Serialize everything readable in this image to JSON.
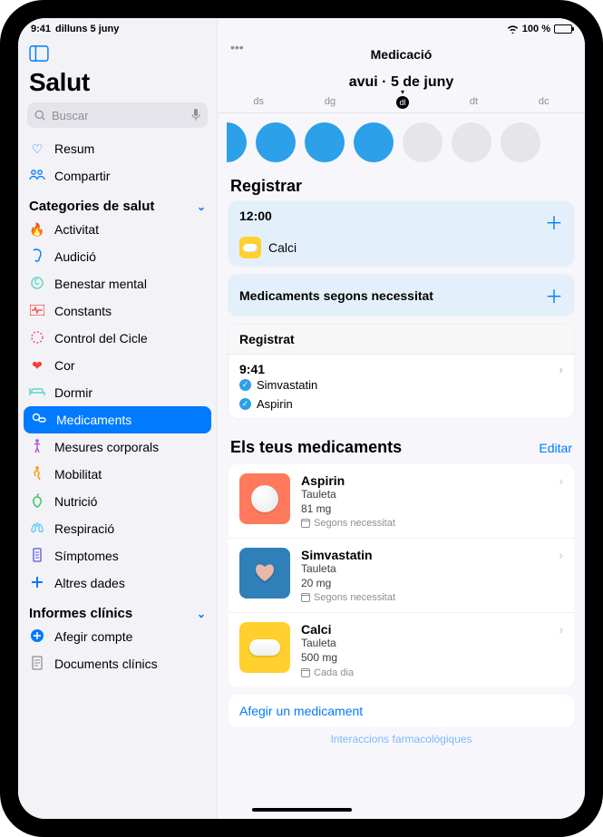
{
  "status": {
    "time": "9:41",
    "date": "dilluns 5 juny",
    "battery": "100 %"
  },
  "sidebar": {
    "app_title": "Salut",
    "search_placeholder": "Buscar",
    "top": [
      {
        "label": "Resum"
      },
      {
        "label": "Compartir"
      }
    ],
    "categories_header": "Categories de salut",
    "categories": [
      {
        "label": "Activitat"
      },
      {
        "label": "Audició"
      },
      {
        "label": "Benestar mental"
      },
      {
        "label": "Constants"
      },
      {
        "label": "Control del Cicle"
      },
      {
        "label": "Cor"
      },
      {
        "label": "Dormir"
      },
      {
        "label": "Medicaments"
      },
      {
        "label": "Mesures corporals"
      },
      {
        "label": "Mobilitat"
      },
      {
        "label": "Nutrició"
      },
      {
        "label": "Respiració"
      },
      {
        "label": "Símptomes"
      },
      {
        "label": "Altres dades"
      }
    ],
    "clinical_header": "Informes clínics",
    "clinical": [
      {
        "label": "Afegir compte"
      },
      {
        "label": "Documents clínics"
      }
    ]
  },
  "main": {
    "title": "Medicació",
    "subtitle": "avui · 5 de juny",
    "days": [
      "ds",
      "dg",
      "dl",
      "dt",
      "dc"
    ],
    "active_day_index": 2,
    "register_header": "Registrar",
    "schedule_time": "12:00",
    "schedule_med": "Calci",
    "prn_label": "Medicaments segons necessitat",
    "logged_header": "Registrat",
    "logged_time": "9:41",
    "logged_meds": [
      "Simvastatin",
      "Aspirin"
    ],
    "yourmeds_header": "Els teus medicaments",
    "edit_label": "Editar",
    "medications": [
      {
        "name": "Aspirin",
        "form": "Tauleta",
        "dose": "81 mg",
        "schedule": "Segons necessitat",
        "bg": "#ff7a5c"
      },
      {
        "name": "Simvastatin",
        "form": "Tauleta",
        "dose": "20 mg",
        "schedule": "Segons necessitat",
        "bg": "#2f7fb8"
      },
      {
        "name": "Calci",
        "form": "Tauleta",
        "dose": "500 mg",
        "schedule": "Cada dia",
        "bg": "#ffd02e"
      }
    ],
    "add_med_label": "Afegir un medicament",
    "truncated_link": "Interaccions farmacològiques"
  }
}
